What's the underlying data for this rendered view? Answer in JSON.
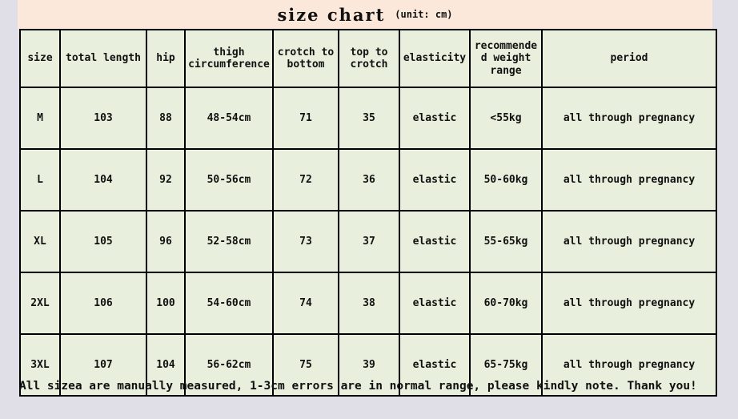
{
  "title": {
    "main": "size chart",
    "unit": "(unit: cm)"
  },
  "colors": {
    "page_background": "#e0dee7",
    "title_band": "#fce8da",
    "cell_background": "#e8efdc",
    "border": "#000000",
    "text": "#111111"
  },
  "table": {
    "headers": [
      "size",
      "total length",
      "hip",
      "thigh circumference",
      "crotch to bottom",
      "top to crotch",
      "elasticity",
      "recommended weight range",
      "period"
    ],
    "rows": [
      {
        "size": "M",
        "total_length": "103",
        "hip": "88",
        "thigh_circumference": "48-54cm",
        "crotch_to_bottom": "71",
        "top_to_crotch": "35",
        "elasticity": "elastic",
        "weight_range": "<55kg",
        "period": "all through pregnancy"
      },
      {
        "size": "L",
        "total_length": "104",
        "hip": "92",
        "thigh_circumference": "50-56cm",
        "crotch_to_bottom": "72",
        "top_to_crotch": "36",
        "elasticity": "elastic",
        "weight_range": "50-60kg",
        "period": "all through pregnancy"
      },
      {
        "size": "XL",
        "total_length": "105",
        "hip": "96",
        "thigh_circumference": "52-58cm",
        "crotch_to_bottom": "73",
        "top_to_crotch": "37",
        "elasticity": "elastic",
        "weight_range": "55-65kg",
        "period": "all through pregnancy"
      },
      {
        "size": "2XL",
        "total_length": "106",
        "hip": "100",
        "thigh_circumference": "54-60cm",
        "crotch_to_bottom": "74",
        "top_to_crotch": "38",
        "elasticity": "elastic",
        "weight_range": "60-70kg",
        "period": "all through pregnancy"
      },
      {
        "size": "3XL",
        "total_length": "107",
        "hip": "104",
        "thigh_circumference": "56-62cm",
        "crotch_to_bottom": "75",
        "top_to_crotch": "39",
        "elasticity": "elastic",
        "weight_range": "65-75kg",
        "period": "all through pregnancy"
      }
    ]
  },
  "footer": {
    "note": "All sizea are manually measured, 1-3cm errors are in normal range, please kindly note. Thank you!"
  }
}
